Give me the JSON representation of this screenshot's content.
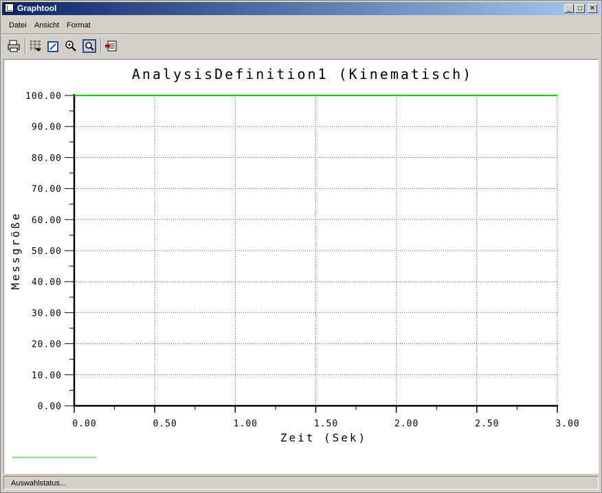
{
  "window": {
    "title": "Graphtool",
    "controls": {
      "minimize": "_",
      "maximize": "□",
      "close": "✕"
    }
  },
  "menu": {
    "items": [
      {
        "label": "Datei"
      },
      {
        "label": "Ansicht"
      },
      {
        "label": "Format"
      }
    ]
  },
  "toolbar": {
    "icons": [
      "printer-icon",
      "grid-icon",
      "edit-curve-icon",
      "zoom-in-icon",
      "zoom-fit-icon",
      "export-icon"
    ]
  },
  "status": {
    "text": "Auswahlstatus..."
  },
  "colors": {
    "series": "#00dd00",
    "grid": "#555555",
    "axis": "#000000"
  },
  "chart_data": {
    "type": "line",
    "title": "AnalysisDefinition1 (Kinematisch)",
    "xlabel": "Zeit (Sek)",
    "ylabel": "Messgröße",
    "xlim": [
      0,
      3
    ],
    "ylim": [
      0,
      100
    ],
    "x_ticks": [
      "0.00",
      "0.50",
      "1.00",
      "1.50",
      "2.00",
      "2.50",
      "3.00"
    ],
    "y_ticks": [
      "0.00",
      "10.00",
      "20.00",
      "30.00",
      "40.00",
      "50.00",
      "60.00",
      "70.00",
      "80.00",
      "90.00",
      "100.00"
    ],
    "grid": true,
    "series": [
      {
        "x": [
          0,
          3
        ],
        "y": [
          100,
          100
        ]
      }
    ]
  }
}
